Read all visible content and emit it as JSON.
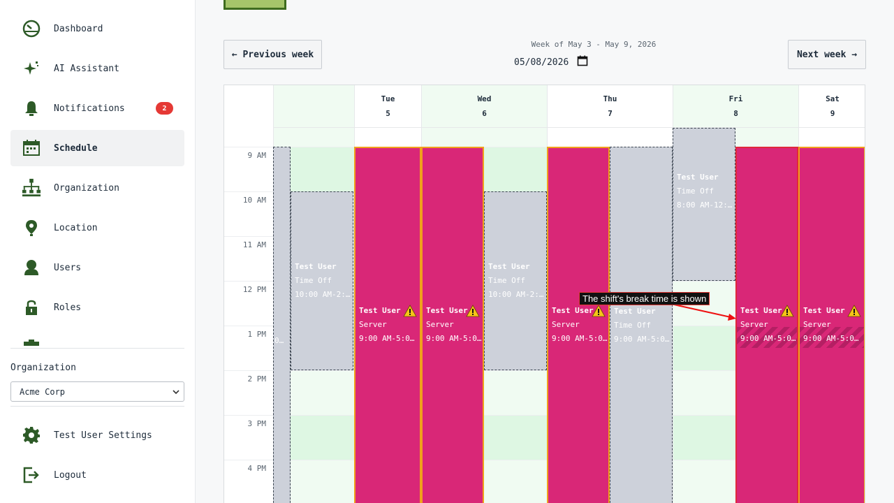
{
  "sidebar": {
    "items": [
      {
        "label": "Dashboard",
        "icon": "dashboard-icon"
      },
      {
        "label": "AI Assistant",
        "icon": "sparkle-icon"
      },
      {
        "label": "Notifications",
        "icon": "bell-icon",
        "badge": "2"
      },
      {
        "label": "Schedule",
        "icon": "calendar-icon",
        "active": true
      },
      {
        "label": "Organization",
        "icon": "org-chart-icon"
      },
      {
        "label": "Location",
        "icon": "location-pin-icon"
      },
      {
        "label": "Users",
        "icon": "user-icon"
      },
      {
        "label": "Roles",
        "icon": "lock-icon"
      }
    ],
    "org_label": "Organization",
    "org_value": "Acme Corp",
    "settings_label": "Test User Settings",
    "logout_label": "Logout"
  },
  "toolbar": {
    "prev_label": "← Previous week",
    "next_label": "Next week →",
    "week_label": "Week of May 3 - May 9, 2026",
    "date_value": "05/08/2026"
  },
  "calendar": {
    "days": [
      {
        "name": "",
        "date": ""
      },
      {
        "name": "Tue",
        "date": "5"
      },
      {
        "name": "Wed",
        "date": "6"
      },
      {
        "name": "Thu",
        "date": "7"
      },
      {
        "name": "Fri",
        "date": "8"
      },
      {
        "name": "Sat",
        "date": "9"
      }
    ],
    "hours": [
      "9 AM",
      "10 AM",
      "11 AM",
      "12 PM",
      "1 PM",
      "2 PM",
      "3 PM",
      "4 PM"
    ],
    "shift": {
      "user": "Test User",
      "role": "Server",
      "time": "9:00 AM-5:0…"
    },
    "timeoff_mon": {
      "user": "Test User",
      "role": "Time Off",
      "time": "10:00 AM-2:…"
    },
    "timeoff_wed": {
      "user": "Test User",
      "role": "Time Off",
      "time": "10:00 AM-2:…"
    },
    "timeoff_thu": {
      "user": "Test User",
      "role": "Time Off",
      "time": "9:00 AM-5:0…"
    },
    "timeoff_fri": {
      "user": "Test User",
      "role": "Time Off",
      "time": "8:00 AM-12:…"
    },
    "clip_text": "0…"
  },
  "annotation": {
    "text": "The shift's break time is shown"
  },
  "colors": {
    "shift": "#d92777",
    "shift_border": "#f0a11c",
    "timeoff": "#cdd1da",
    "green_band": "#e8f8ec",
    "badge": "#e53935"
  }
}
